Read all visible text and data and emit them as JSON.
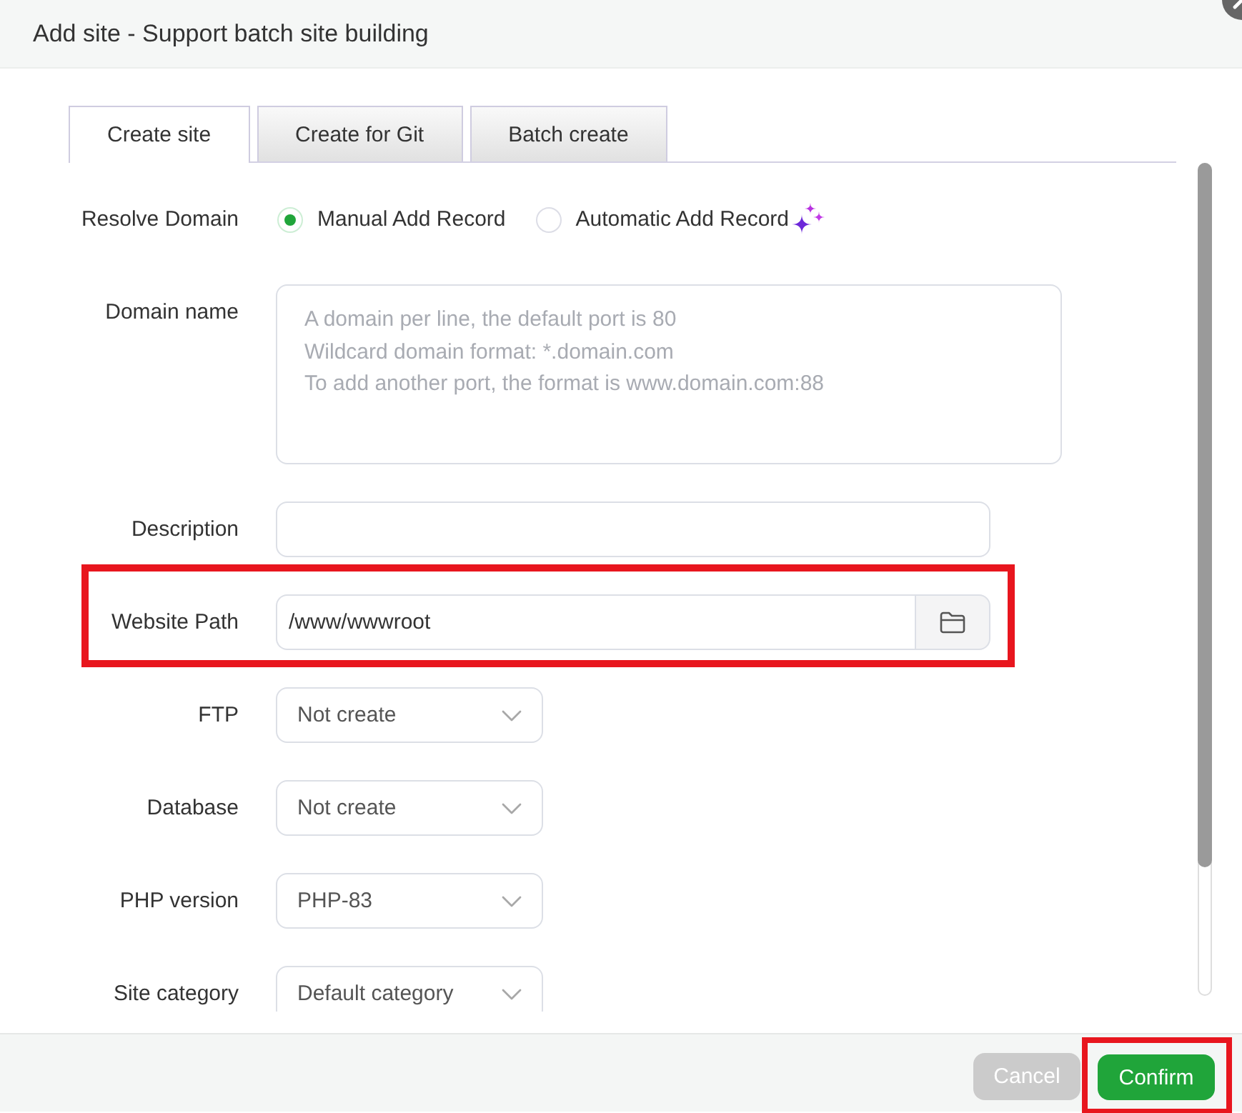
{
  "dialog": {
    "title": "Add site - Support batch site building"
  },
  "tabs": [
    {
      "label": "Create site",
      "selected": true
    },
    {
      "label": "Create for Git",
      "selected": false
    },
    {
      "label": "Batch create",
      "selected": false
    }
  ],
  "form": {
    "rows": [
      {
        "kind": "radio",
        "label": "Resolve Domain",
        "highlighted": false,
        "options": [
          {
            "label": "Manual Add Record",
            "selected": true,
            "sparkle": false
          },
          {
            "label": "Automatic Add Record",
            "selected": false,
            "sparkle": true
          }
        ]
      },
      {
        "kind": "textarea",
        "label": "Domain name",
        "highlighted": false,
        "placeholder": "A domain per line, the default port is 80\nWildcard domain format: *.domain.com\nTo add another port, the format is www.domain.com:88"
      },
      {
        "kind": "text",
        "label": "Description",
        "highlighted": false
      },
      {
        "kind": "path",
        "label": "Website Path",
        "value": "/www/wwwroot",
        "highlighted": true
      },
      {
        "kind": "select",
        "label": "FTP",
        "value": "Not create",
        "highlighted": false
      },
      {
        "kind": "select",
        "label": "Database",
        "value": "Not create",
        "highlighted": false
      },
      {
        "kind": "select",
        "label": "PHP version",
        "value": "PHP-83",
        "highlighted": false
      },
      {
        "kind": "select",
        "label": "Site category",
        "value": "Default category",
        "highlighted": false
      }
    ]
  },
  "buttons": [
    {
      "label": "Cancel",
      "kind": "secondary",
      "highlighted": false
    },
    {
      "label": "Confirm",
      "kind": "primary",
      "highlighted": true
    }
  ]
}
